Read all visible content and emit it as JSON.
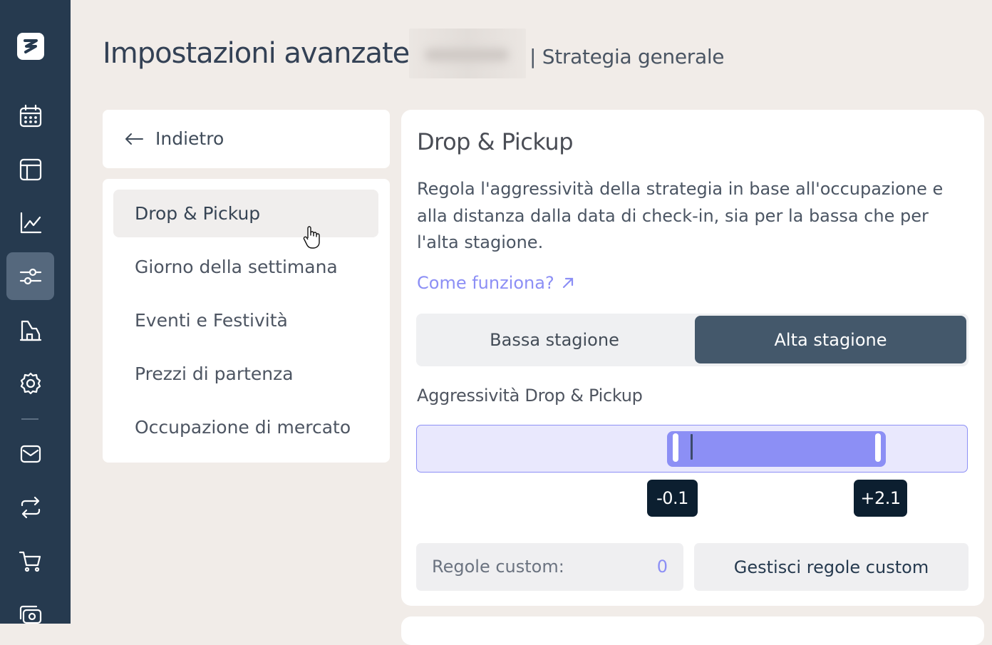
{
  "header": {
    "title": "Impostazioni avanzate",
    "subtitle": "| Strategia generale"
  },
  "rail": {
    "items": [
      {
        "icon": "logo-icon"
      },
      {
        "icon": "calendar-icon"
      },
      {
        "icon": "layout-icon"
      },
      {
        "icon": "chart-line-icon"
      },
      {
        "icon": "sliders-icon",
        "active": true
      },
      {
        "icon": "building-icon"
      },
      {
        "icon": "gear-icon"
      },
      {
        "icon": "mail-icon"
      },
      {
        "icon": "repeat-icon"
      },
      {
        "icon": "cart-icon"
      },
      {
        "icon": "money-icon"
      }
    ]
  },
  "nav": {
    "back_label": "Indietro",
    "items": [
      {
        "label": "Drop & Pickup",
        "active": true
      },
      {
        "label": "Giorno della settimana"
      },
      {
        "label": "Eventi e Festività"
      },
      {
        "label": "Prezzi di partenza"
      },
      {
        "label": "Occupazione di mercato"
      }
    ]
  },
  "panel": {
    "title": "Drop & Pickup",
    "description": "Regola l'aggressività della strategia in base all'occupazione e alla distanza dalla data di check-in, sia per la bassa che per l'alta stagione.",
    "link": "Come funziona?",
    "tabs": [
      {
        "label": "Bassa stagione",
        "active": false
      },
      {
        "label": "Alta stagione",
        "active": true
      }
    ],
    "slider_label": "Aggressività Drop & Pickup",
    "slider": {
      "min_label": "-0.1",
      "max_label": "+2.1",
      "min": -0.1,
      "max": 2.1
    },
    "custom_rules_label": "Regole custom:",
    "custom_rules_count": "0",
    "manage_button": "Gestisci regole custom"
  },
  "colors": {
    "rail": "#263a4f",
    "accent": "#8c8ff5",
    "active_tab": "#44586b",
    "tag": "#0c1f30",
    "background": "#f1ece8"
  }
}
